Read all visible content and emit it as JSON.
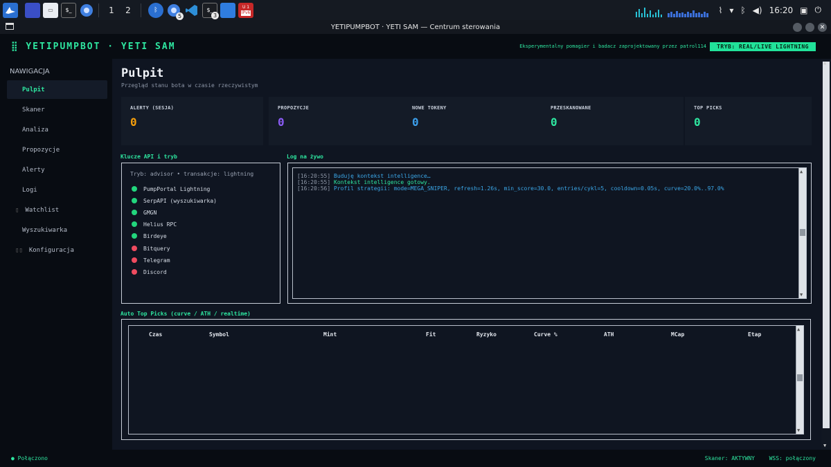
{
  "taskbar": {
    "workspaces": [
      "1",
      "2"
    ],
    "badges": {
      "chrome2": "5",
      "term2": "3"
    },
    "ipv6_label": "IPv6",
    "ipv6_top": "U 1",
    "time": "16:20",
    "term_label": "$_"
  },
  "window": {
    "title": "YETIPUMPBOT · YETI SAM — Centrum sterowania"
  },
  "header": {
    "brand": "⣿ YETIPUMPBOT · YETI SAM",
    "credit": "Eksperymentalny pomagier i badacz zaprojektowany przez patrol114",
    "mode": "TRYB: REAL/LIVE LIGHTNING"
  },
  "sidebar": {
    "heading": "NAWIGACJA",
    "items": [
      {
        "label": "Pulpit",
        "icon": ""
      },
      {
        "label": "Skaner",
        "icon": ""
      },
      {
        "label": "Analiza",
        "icon": ""
      },
      {
        "label": "Propozycje",
        "icon": ""
      },
      {
        "label": "Alerty",
        "icon": ""
      },
      {
        "label": "Logi",
        "icon": ""
      },
      {
        "label": "Watchlist",
        "icon": "▯"
      },
      {
        "label": "Wyszukiwarka",
        "icon": ""
      },
      {
        "label": "Konfiguracja",
        "icon": "▯▯"
      }
    ]
  },
  "page": {
    "title": "Pulpit",
    "subtitle": "Przegląd stanu bota w czasie rzeczywistym"
  },
  "cards": [
    {
      "label": "ALERTY (SESJA)",
      "value": "0",
      "color": "#f59e0b"
    },
    {
      "label": "PROPOZYCJE",
      "value": "0",
      "color": "#8b5cf6"
    },
    {
      "label": "NOWE TOKENY",
      "value": "0",
      "color": "#3b9eea"
    },
    {
      "label": "PRZESKANOWANE",
      "value": "0",
      "color": "#2ee6a0"
    },
    {
      "label": "TOP PICKS",
      "value": "0",
      "color": "#2ee6a0"
    }
  ],
  "api": {
    "title": "Klucze API i tryb",
    "mode": "Tryb: advisor  •  transakcje: lightning",
    "items": [
      {
        "name": "PumpPortal Lightning",
        "status": "ok"
      },
      {
        "name": "SerpAPI (wyszukiwarka)",
        "status": "ok"
      },
      {
        "name": "GMGN",
        "status": "ok"
      },
      {
        "name": "Helius RPC",
        "status": "ok"
      },
      {
        "name": "Birdeye",
        "status": "ok"
      },
      {
        "name": "Bitquery",
        "status": "error"
      },
      {
        "name": "Telegram",
        "status": "error"
      },
      {
        "name": "Discord",
        "status": "error"
      }
    ]
  },
  "colors": {
    "ok": "#22d67d",
    "error": "#ef4b5f",
    "accent": "#2ee6a0",
    "log_blue": "#3ba7e8",
    "log_ts": "#8f98a8"
  },
  "log": {
    "title": "Log na żywo",
    "lines": [
      {
        "ts": "[16:20:55]",
        "msg": "Buduję kontekst intelligence…",
        "color": "#3ba7e8"
      },
      {
        "ts": "[16:20:55]",
        "msg": "Kontekst intelligence gotowy.",
        "color": "#2ee6a0"
      },
      {
        "ts": "[16:20:56]",
        "msg": "Profil strategii: mode=MEGA_SNIPER, refresh=1.26s, min_score=30.0, entries/cykl=5, cooldown=0.05s, curve=20.0%..97.0%",
        "color": "#3ba7e8"
      }
    ]
  },
  "toppicks": {
    "title": "Auto Top Picks (curve / ATH / realtime)",
    "columns": [
      "Czas",
      "Symbol",
      "Mint",
      "Fit",
      "Ryzyko",
      "Curve %",
      "ATH",
      "MCap",
      "Etap"
    ],
    "rows": []
  },
  "status": {
    "connection": "● Połączono",
    "scanner": "Skaner: AKTYWNY",
    "wss": "WSS: połączony"
  }
}
